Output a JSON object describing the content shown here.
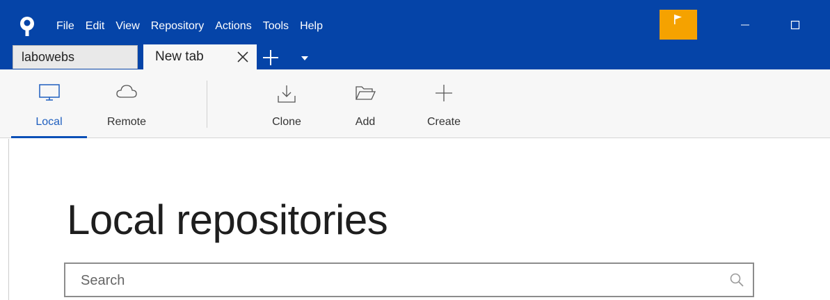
{
  "menu": [
    "File",
    "Edit",
    "View",
    "Repository",
    "Actions",
    "Tools",
    "Help"
  ],
  "tabs": [
    {
      "label": "labowebs",
      "active": false
    },
    {
      "label": "New tab",
      "active": true
    }
  ],
  "toolbar": {
    "local_label": "Local",
    "remote_label": "Remote",
    "clone_label": "Clone",
    "add_label": "Add",
    "create_label": "Create"
  },
  "main": {
    "title": "Local repositories",
    "search_placeholder": "Search",
    "search_value": ""
  },
  "colors": {
    "titlebar": "#0544a8",
    "flag_button": "#f5a200",
    "accent": "#1f5fbf"
  },
  "icons": [
    "app-logo-icon",
    "flag-icon",
    "minimize-icon",
    "maximize-icon",
    "close-icon",
    "plus-icon",
    "chevron-down-icon",
    "monitor-icon",
    "cloud-icon",
    "download-icon",
    "folder-icon",
    "search-icon"
  ]
}
